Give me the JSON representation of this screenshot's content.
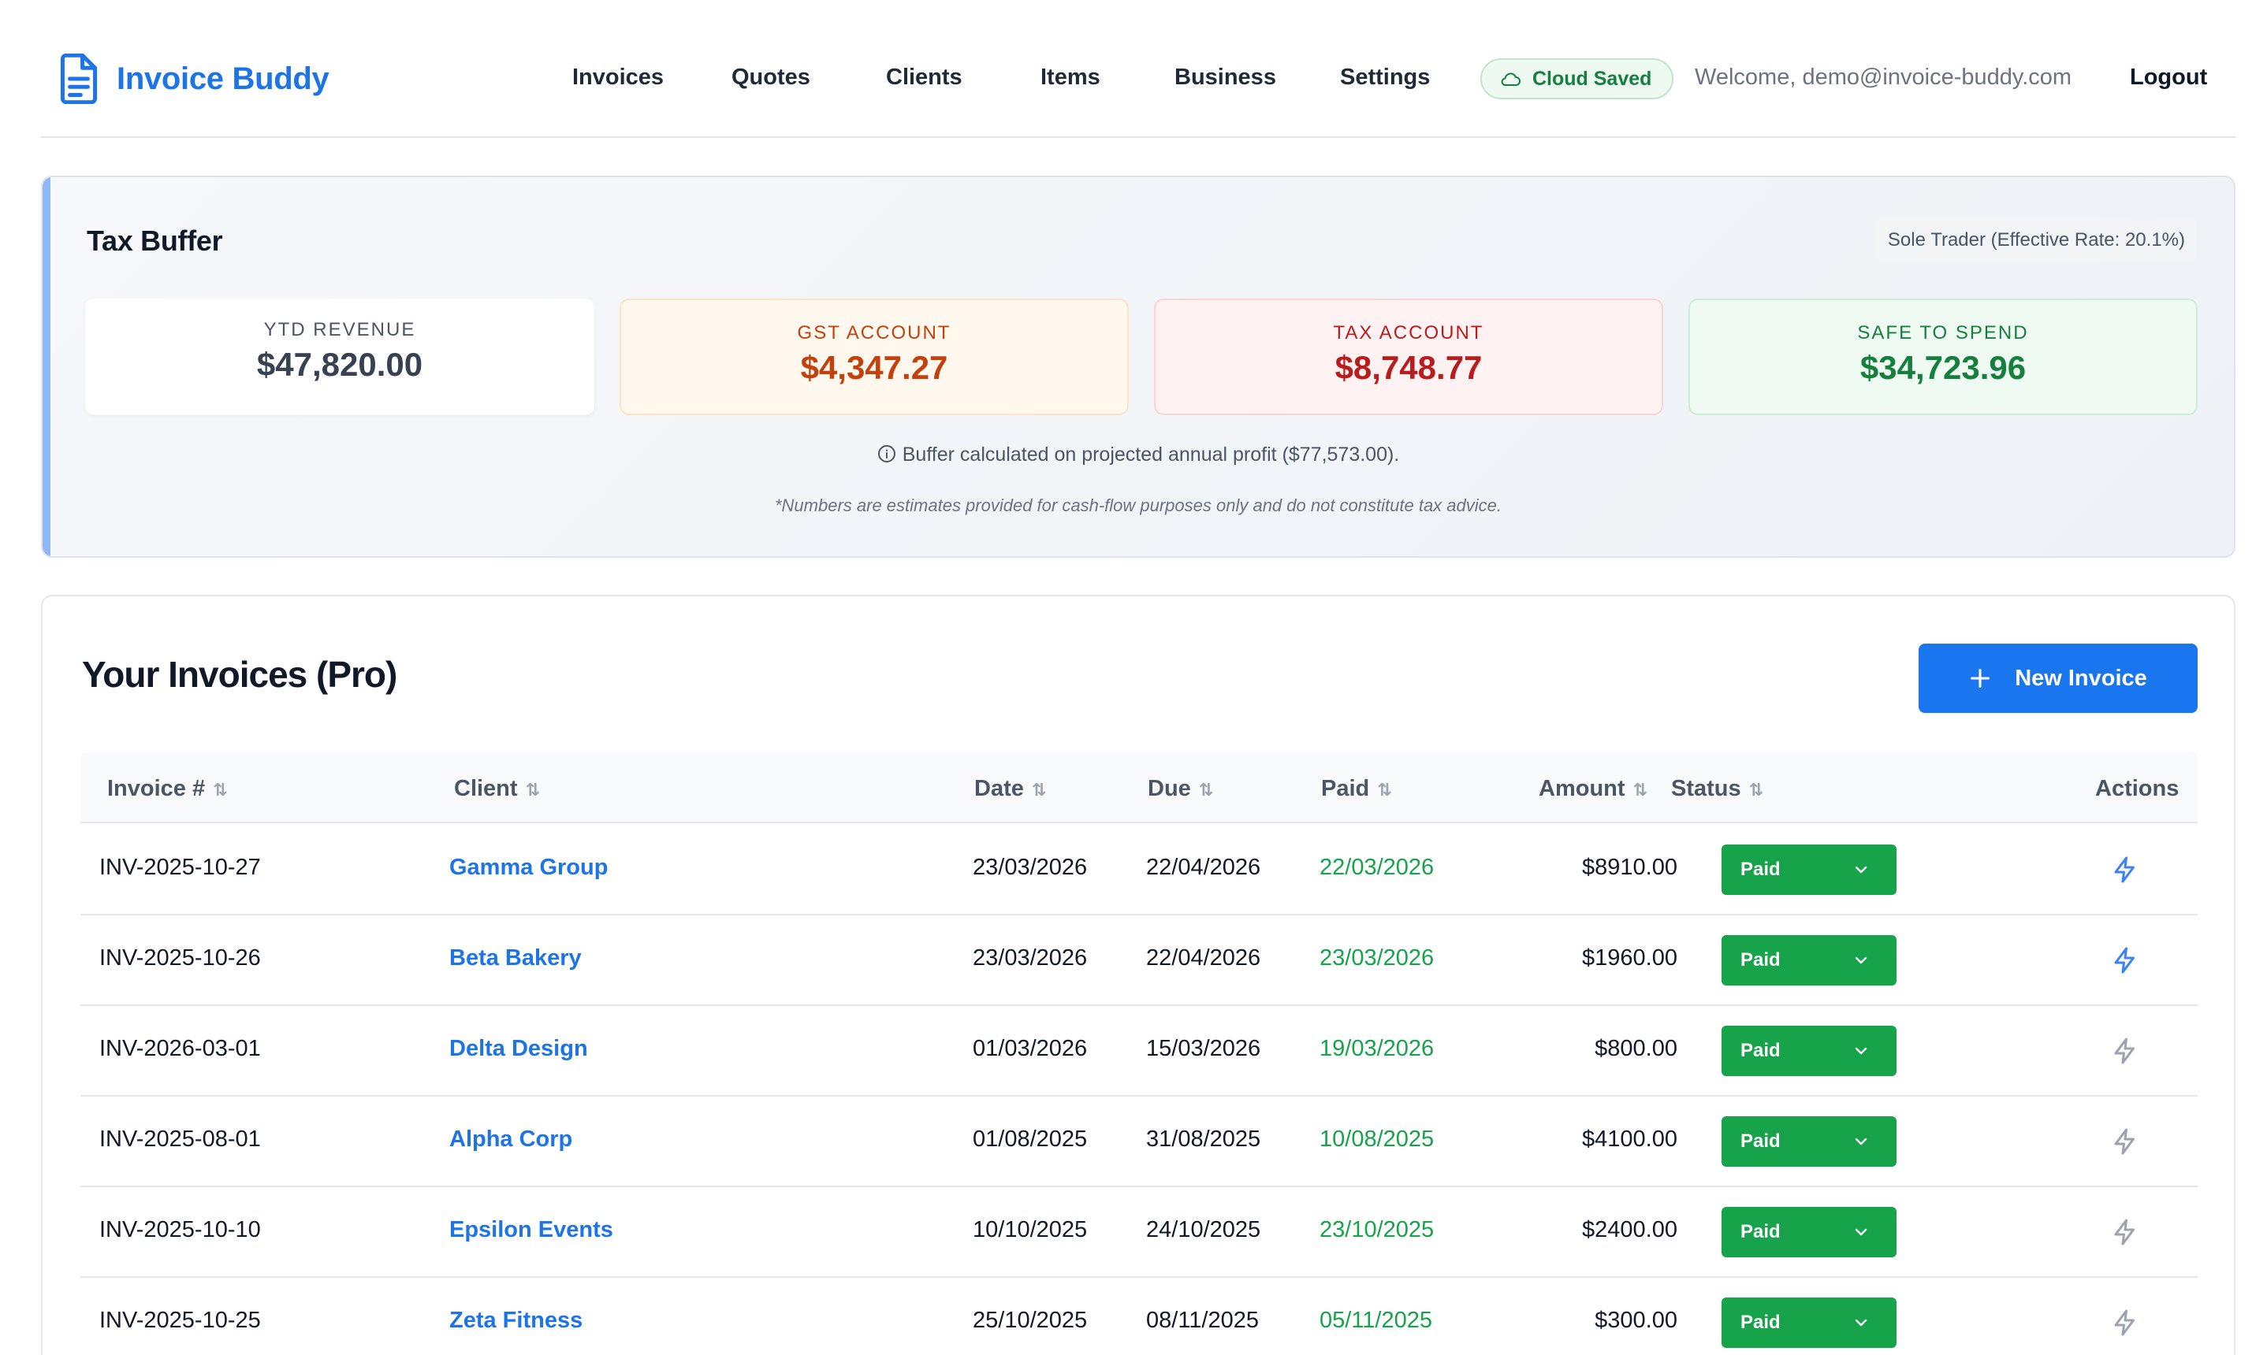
{
  "app": {
    "name": "Invoice Buddy"
  },
  "nav": {
    "items": [
      {
        "label": "Invoices"
      },
      {
        "label": "Quotes"
      },
      {
        "label": "Clients"
      },
      {
        "label": "Items"
      },
      {
        "label": "Business"
      },
      {
        "label": "Settings"
      }
    ],
    "cloud_status": "Cloud Saved",
    "welcome": "Welcome, demo@invoice-buddy.com",
    "logout": "Logout"
  },
  "tax_buffer": {
    "title": "Tax Buffer",
    "mode": "Sole Trader (Effective Rate: 20.1%)",
    "stats": [
      {
        "label": "YTD REVENUE",
        "value": "$47,820.00"
      },
      {
        "label": "GST ACCOUNT",
        "value": "$4,347.27"
      },
      {
        "label": "TAX ACCOUNT",
        "value": "$8,748.77"
      },
      {
        "label": "SAFE TO SPEND",
        "value": "$34,723.96"
      }
    ],
    "note": "Buffer calculated on projected annual profit ($77,573.00).",
    "disclaimer": "*Numbers are estimates provided for cash-flow purposes only and do not constitute tax advice."
  },
  "invoices": {
    "title": "Your Invoices (Pro)",
    "new_button": "New Invoice",
    "columns": {
      "invoice": "Invoice #",
      "client": "Client",
      "date": "Date",
      "due": "Due",
      "paid": "Paid",
      "amount": "Amount",
      "status": "Status",
      "actions": "Actions"
    },
    "rows": [
      {
        "number": "INV-2025-10-27",
        "client": "Gamma Group",
        "date": "23/03/2026",
        "due": "22/04/2026",
        "paid": "22/03/2026",
        "amount": "$8910.00",
        "status": "Paid",
        "action_color": "#3b82f6"
      },
      {
        "number": "INV-2025-10-26",
        "client": "Beta Bakery",
        "date": "23/03/2026",
        "due": "22/04/2026",
        "paid": "23/03/2026",
        "amount": "$1960.00",
        "status": "Paid",
        "action_color": "#3b82f6"
      },
      {
        "number": "INV-2026-03-01",
        "client": "Delta Design",
        "date": "01/03/2026",
        "due": "15/03/2026",
        "paid": "19/03/2026",
        "amount": "$800.00",
        "status": "Paid",
        "action_color": "#9ca3af"
      },
      {
        "number": "INV-2025-08-01",
        "client": "Alpha Corp",
        "date": "01/08/2025",
        "due": "31/08/2025",
        "paid": "10/08/2025",
        "amount": "$4100.00",
        "status": "Paid",
        "action_color": "#9ca3af"
      },
      {
        "number": "INV-2025-10-10",
        "client": "Epsilon Events",
        "date": "10/10/2025",
        "due": "24/10/2025",
        "paid": "23/10/2025",
        "amount": "$2400.00",
        "status": "Paid",
        "action_color": "#9ca3af"
      },
      {
        "number": "INV-2025-10-25",
        "client": "Zeta Fitness",
        "date": "25/10/2025",
        "due": "08/11/2025",
        "paid": "05/11/2025",
        "amount": "$300.00",
        "status": "Paid",
        "action_color": "#9ca3af"
      }
    ]
  },
  "icons": {
    "logo": "document-icon",
    "cloud": "cloud-icon",
    "info": "info-icon",
    "plus": "plus-icon",
    "sort": "sort-icon",
    "chevron": "chevron-down-icon",
    "action": "lightning-icon"
  },
  "colors": {
    "brand": "#1d74e7",
    "primary_button": "#1976ef",
    "paid_green": "#16a34a",
    "gst": "#c2410c",
    "tax": "#b91c1c",
    "safe": "#15803d"
  }
}
